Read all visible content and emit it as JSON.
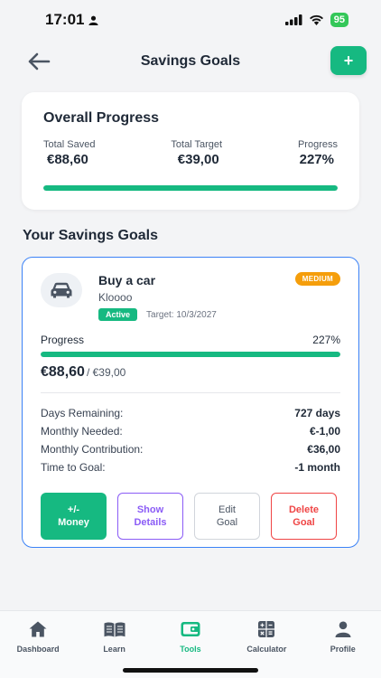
{
  "status_bar": {
    "time": "17:01",
    "battery": "95"
  },
  "header": {
    "title": "Savings Goals",
    "add_label": "+"
  },
  "overall": {
    "title": "Overall Progress",
    "total_saved_label": "Total Saved",
    "total_saved_value": "€88,60",
    "total_target_label": "Total Target",
    "total_target_value": "€39,00",
    "progress_label": "Progress",
    "progress_value": "227%",
    "progress_fraction": 1.0
  },
  "section_title": "Your Savings Goals",
  "goal": {
    "name": "Buy a car",
    "description": "Kloooo",
    "status": "Active",
    "target_date": "Target: 10/3/2027",
    "priority": "MEDIUM",
    "progress_label": "Progress",
    "progress_value": "227%",
    "progress_fraction": 1.0,
    "saved": "€88,60",
    "target": "/ €39,00",
    "details": [
      {
        "label": "Days Remaining:",
        "value": "727 days"
      },
      {
        "label": "Monthly Needed:",
        "value": "€-1,00"
      },
      {
        "label": "Monthly Contribution:",
        "value": "€36,00"
      },
      {
        "label": "Time to Goal:",
        "value": "-1 month"
      }
    ],
    "actions": {
      "money": "+/-\nMoney",
      "show": "Show\nDetails",
      "edit": "Edit\nGoal",
      "delete": "Delete\nGoal"
    }
  },
  "nav": {
    "items": [
      {
        "label": "Dashboard",
        "icon": "home-icon"
      },
      {
        "label": "Learn",
        "icon": "book-icon"
      },
      {
        "label": "Tools",
        "icon": "wallet-icon"
      },
      {
        "label": "Calculator",
        "icon": "calculator-icon"
      },
      {
        "label": "Profile",
        "icon": "person-icon"
      }
    ],
    "active_index": 2
  },
  "colors": {
    "accent": "#16b981",
    "card_border": "#3b82f6",
    "priority": "#f59e0b",
    "show_details": "#8b5cf6",
    "delete": "#ef4444"
  }
}
